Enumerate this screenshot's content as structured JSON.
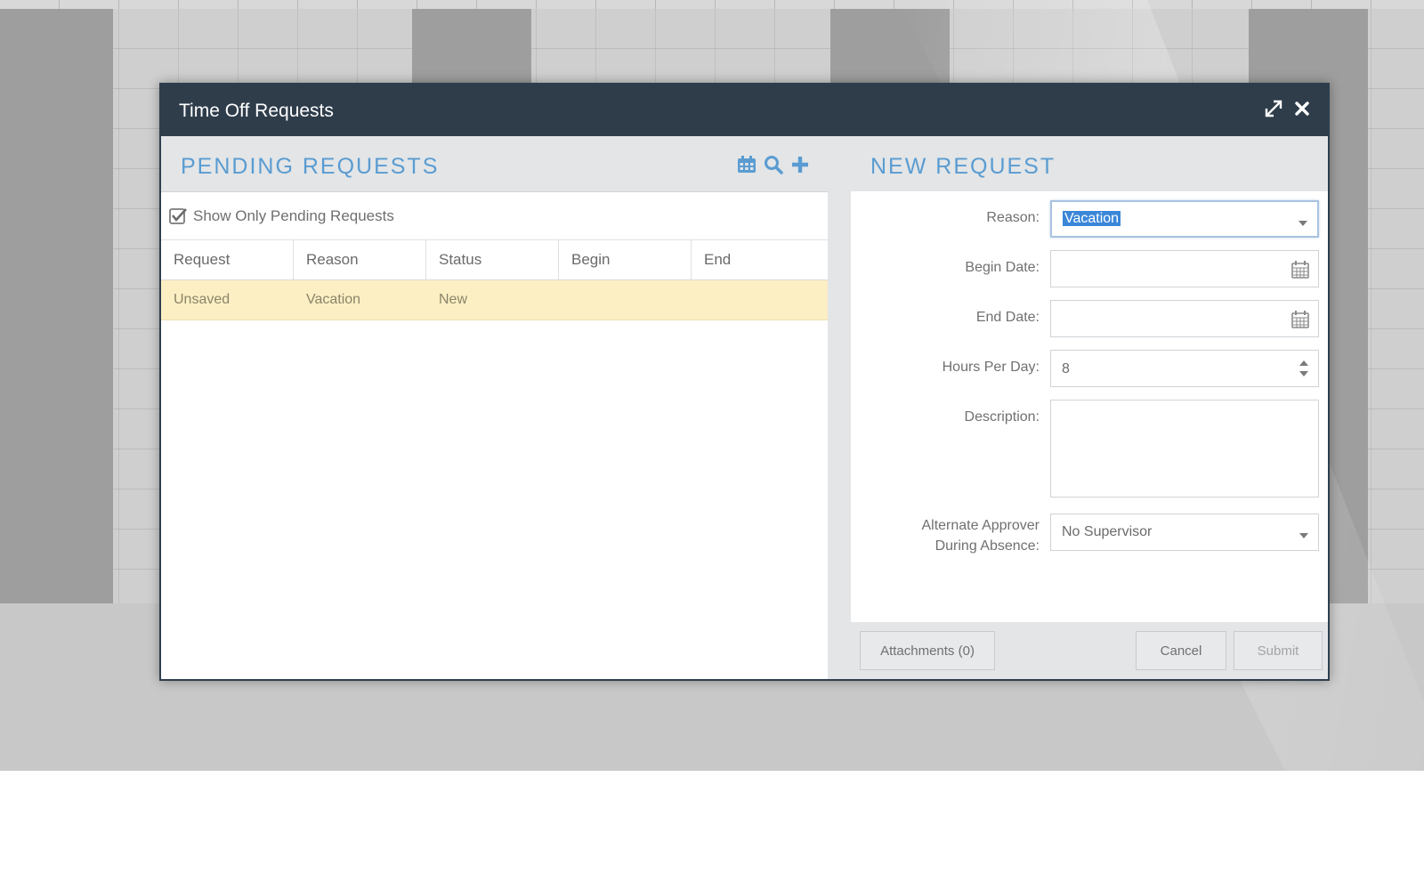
{
  "dialog": {
    "title": "Time Off Requests",
    "icons": [
      "expand-icon",
      "close-icon"
    ]
  },
  "pending": {
    "title": "PENDING REQUESTS",
    "tools": [
      "calendar-icon",
      "search-icon",
      "add-icon"
    ],
    "filter": {
      "label": "Show Only Pending Requests",
      "checked": true
    },
    "columns": [
      "Request",
      "Reason",
      "Status",
      "Begin",
      "End"
    ],
    "rows": [
      {
        "request": "Unsaved",
        "reason": "Vacation",
        "status": "New",
        "begin": "",
        "end": ""
      }
    ]
  },
  "new_request": {
    "title": "NEW REQUEST",
    "reason_label": "Reason:",
    "reason_value": "Vacation",
    "begin_label": "Begin Date:",
    "begin_value": "",
    "end_label": "End Date:",
    "end_value": "",
    "hours_label": "Hours Per Day:",
    "hours_value": "8",
    "description_label": "Description:",
    "description_value": "",
    "approver_label": "Alternate Approver During Absence:",
    "approver_value": "No Supervisor"
  },
  "buttons": {
    "attachments": "Attachments (0)",
    "cancel": "Cancel",
    "submit": "Submit"
  },
  "colors": {
    "header_bg": "#2f3d4b",
    "section_title": "#5a9cd1",
    "row_highlight": "#fcefc4",
    "selection": "#3a86d8"
  }
}
